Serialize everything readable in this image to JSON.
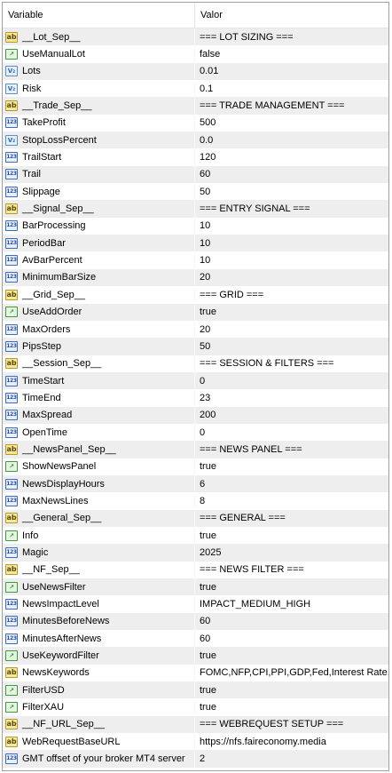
{
  "header": {
    "variable_label": "Variable",
    "value_label": "Valor"
  },
  "rows": [
    {
      "type": "ab",
      "name": "__Lot_Sep__",
      "value": "=== LOT SIZING ==="
    },
    {
      "type": "bool",
      "name": "UseManualLot",
      "value": "false"
    },
    {
      "type": "dbl",
      "name": "Lots",
      "value": "0.01"
    },
    {
      "type": "dbl",
      "name": "Risk",
      "value": "0.1"
    },
    {
      "type": "ab",
      "name": "__Trade_Sep__",
      "value": "=== TRADE MANAGEMENT ==="
    },
    {
      "type": "int",
      "name": "TakeProfit",
      "value": "500"
    },
    {
      "type": "dbl",
      "name": "StopLossPercent",
      "value": "0.0"
    },
    {
      "type": "int",
      "name": "TrailStart",
      "value": "120"
    },
    {
      "type": "int",
      "name": "Trail",
      "value": "60"
    },
    {
      "type": "int",
      "name": "Slippage",
      "value": "50"
    },
    {
      "type": "ab",
      "name": "__Signal_Sep__",
      "value": "=== ENTRY SIGNAL ==="
    },
    {
      "type": "int",
      "name": "BarProcessing",
      "value": "10"
    },
    {
      "type": "int",
      "name": "PeriodBar",
      "value": "10"
    },
    {
      "type": "int",
      "name": "AvBarPercent",
      "value": "10"
    },
    {
      "type": "int",
      "name": "MinimumBarSize",
      "value": "20"
    },
    {
      "type": "ab",
      "name": "__Grid_Sep__",
      "value": "=== GRID ==="
    },
    {
      "type": "bool",
      "name": "UseAddOrder",
      "value": "true"
    },
    {
      "type": "int",
      "name": "MaxOrders",
      "value": "20"
    },
    {
      "type": "int",
      "name": "PipsStep",
      "value": "50"
    },
    {
      "type": "ab",
      "name": "__Session_Sep__",
      "value": "=== SESSION & FILTERS ==="
    },
    {
      "type": "int",
      "name": "TimeStart",
      "value": "0"
    },
    {
      "type": "int",
      "name": "TimeEnd",
      "value": "23"
    },
    {
      "type": "int",
      "name": "MaxSpread",
      "value": "200"
    },
    {
      "type": "int",
      "name": "OpenTime",
      "value": "0"
    },
    {
      "type": "ab",
      "name": "__NewsPanel_Sep__",
      "value": "=== NEWS PANEL ==="
    },
    {
      "type": "bool",
      "name": "ShowNewsPanel",
      "value": "true"
    },
    {
      "type": "int",
      "name": "NewsDisplayHours",
      "value": "6"
    },
    {
      "type": "int",
      "name": "MaxNewsLines",
      "value": "8"
    },
    {
      "type": "ab",
      "name": "__General_Sep__",
      "value": "=== GENERAL ==="
    },
    {
      "type": "bool",
      "name": "Info",
      "value": "true"
    },
    {
      "type": "int",
      "name": "Magic",
      "value": "2025"
    },
    {
      "type": "ab",
      "name": "__NF_Sep__",
      "value": "=== NEWS FILTER ==="
    },
    {
      "type": "bool",
      "name": "UseNewsFilter",
      "value": "true"
    },
    {
      "type": "int",
      "name": "NewsImpactLevel",
      "value": "IMPACT_MEDIUM_HIGH"
    },
    {
      "type": "int",
      "name": "MinutesBeforeNews",
      "value": "60"
    },
    {
      "type": "int",
      "name": "MinutesAfterNews",
      "value": "60"
    },
    {
      "type": "bool",
      "name": "UseKeywordFilter",
      "value": "true"
    },
    {
      "type": "ab",
      "name": "NewsKeywords",
      "value": "FOMC,NFP,CPI,PPI,GDP,Fed,Interest Rate,..."
    },
    {
      "type": "bool",
      "name": "FilterUSD",
      "value": "true"
    },
    {
      "type": "bool",
      "name": "FilterXAU",
      "value": "true"
    },
    {
      "type": "ab",
      "name": "__NF_URL_Sep__",
      "value": "=== WEBREQUEST SETUP ==="
    },
    {
      "type": "ab",
      "name": "WebRequestBaseURL",
      "value": "https://nfs.faireconomy.media"
    },
    {
      "type": "int",
      "name": "GMT offset of your broker MT4 server",
      "value": "2"
    }
  ],
  "icons": {
    "ab": {
      "glyph": "ab",
      "name": "string-type-icon"
    },
    "bool": {
      "glyph": "↗",
      "name": "bool-type-icon"
    },
    "dbl": {
      "glyph": "V₂",
      "name": "double-type-icon"
    },
    "int": {
      "glyph": "123",
      "name": "int-type-icon"
    }
  }
}
